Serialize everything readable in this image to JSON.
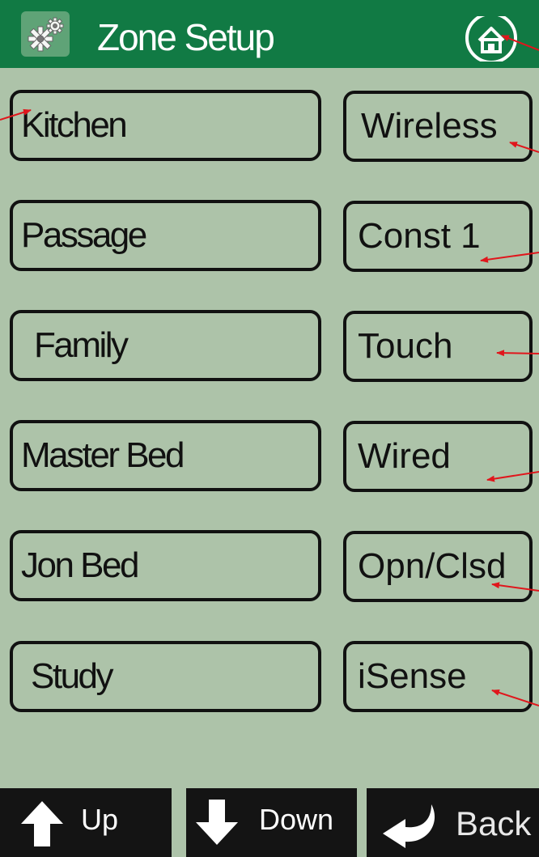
{
  "header": {
    "title": "Zone Setup",
    "settings_icon": "gears-icon",
    "home_icon": "home-icon"
  },
  "zones": [
    {
      "name": "Kitchen",
      "type": "Wireless"
    },
    {
      "name": "Passage",
      "type": "Const 1"
    },
    {
      "name": "Family",
      "type": "Touch"
    },
    {
      "name": "Master Bed",
      "type": "Wired"
    },
    {
      "name": "Jon Bed",
      "type": "Opn/Clsd"
    },
    {
      "name": "Study",
      "type": "iSense"
    }
  ],
  "footer": {
    "up_label": "Up",
    "down_label": "Down",
    "back_label": "Back"
  },
  "colors": {
    "background": "#adc3a9",
    "header": "#117a44",
    "annotation": "#e0161c",
    "footer": "#141414"
  }
}
